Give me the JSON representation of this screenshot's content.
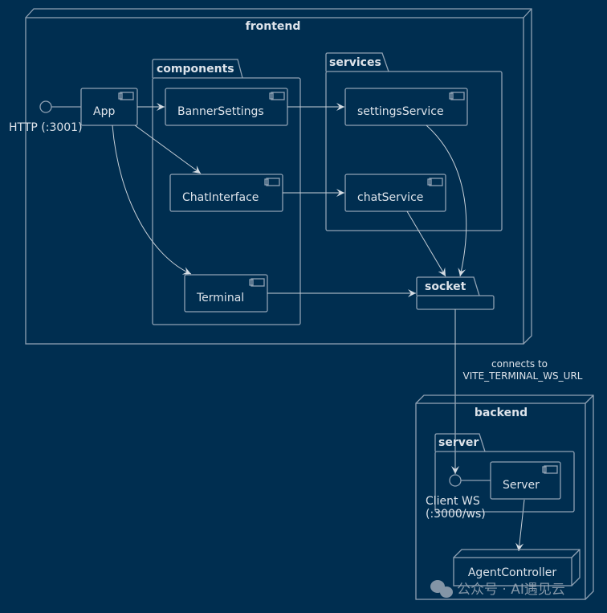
{
  "diagram": {
    "type": "component",
    "nodes": {
      "frontend": {
        "label": "frontend"
      },
      "backend": {
        "label": "backend"
      }
    },
    "packages": {
      "components": {
        "label": "components"
      },
      "services": {
        "label": "services"
      },
      "socket": {
        "label": "socket"
      },
      "server": {
        "label": "server"
      }
    },
    "components": {
      "app": {
        "label": "App"
      },
      "banner_settings": {
        "label": "BannerSettings"
      },
      "chat_interface": {
        "label": "ChatInterface"
      },
      "terminal": {
        "label": "Terminal"
      },
      "settings_service": {
        "label": "settingsService"
      },
      "chat_service": {
        "label": "chatService"
      },
      "server": {
        "label": "Server"
      },
      "agent_controller": {
        "label": "AgentController"
      }
    },
    "interfaces": {
      "http": {
        "label": "HTTP (:3001)"
      },
      "client_ws_line1": {
        "label": "Client WS"
      },
      "client_ws_line2": {
        "label": "(:3000/ws)"
      }
    },
    "edges": [
      {
        "from": "App",
        "to": "BannerSettings"
      },
      {
        "from": "App",
        "to": "ChatInterface"
      },
      {
        "from": "App",
        "to": "Terminal"
      },
      {
        "from": "BannerSettings",
        "to": "settingsService"
      },
      {
        "from": "ChatInterface",
        "to": "chatService"
      },
      {
        "from": "settingsService",
        "to": "socket"
      },
      {
        "from": "chatService",
        "to": "socket"
      },
      {
        "from": "Terminal",
        "to": "socket"
      },
      {
        "from": "socket",
        "to": "Client WS",
        "label_line1": "connects to",
        "label_line2": "VITE_TERMINAL_WS_URL"
      },
      {
        "from": "Server",
        "to": "AgentController"
      }
    ],
    "colors": {
      "background": "#002e50",
      "line": "#8fa1b3",
      "text": "#dde3ea"
    }
  },
  "watermark": {
    "text": "公众号 · AI遇见云"
  }
}
